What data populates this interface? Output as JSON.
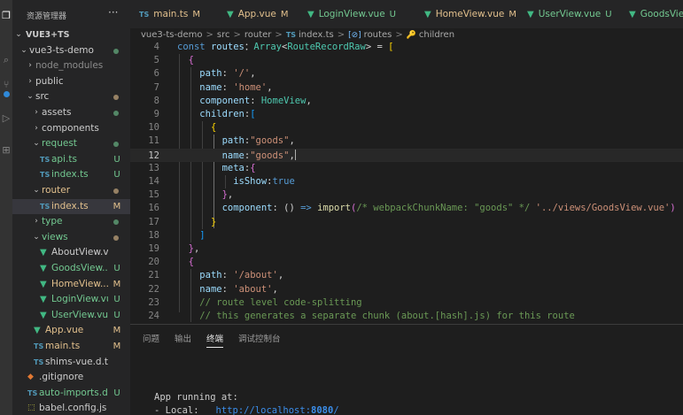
{
  "explorer": {
    "title": "资源管理器",
    "more": "···",
    "project": "VUE3+TS",
    "items": [
      {
        "label": "vue3-ts-demo",
        "kind": "folder",
        "open": true,
        "depth": 0,
        "status": "dot-green"
      },
      {
        "label": "node_modules",
        "kind": "folder",
        "open": false,
        "depth": 1,
        "status": "",
        "dim": true
      },
      {
        "label": "public",
        "kind": "folder",
        "open": false,
        "depth": 1,
        "status": ""
      },
      {
        "label": "src",
        "kind": "folder",
        "open": true,
        "depth": 1,
        "status": "dot-orange"
      },
      {
        "label": "assets",
        "kind": "folder",
        "open": false,
        "depth": 2,
        "status": "dot-green"
      },
      {
        "label": "components",
        "kind": "folder",
        "open": false,
        "depth": 2,
        "status": ""
      },
      {
        "label": "request",
        "kind": "folder",
        "open": true,
        "depth": 2,
        "status": "dot-green",
        "color": "green"
      },
      {
        "label": "api.ts",
        "kind": "ts",
        "depth": 3,
        "status": "U",
        "color": "green"
      },
      {
        "label": "index.ts",
        "kind": "ts",
        "depth": 3,
        "status": "U",
        "color": "green"
      },
      {
        "label": "router",
        "kind": "folder",
        "open": true,
        "depth": 2,
        "status": "dot-orange",
        "color": "mod"
      },
      {
        "label": "index.ts",
        "kind": "ts",
        "depth": 3,
        "status": "M",
        "color": "mod",
        "selected": true
      },
      {
        "label": "type",
        "kind": "folder",
        "open": false,
        "depth": 2,
        "status": "dot-green",
        "color": "green"
      },
      {
        "label": "views",
        "kind": "folder",
        "open": true,
        "depth": 2,
        "status": "dot-orange",
        "color": "green"
      },
      {
        "label": "AboutView.vue",
        "kind": "vue",
        "depth": 3,
        "status": ""
      },
      {
        "label": "GoodsView....",
        "kind": "vue",
        "depth": 3,
        "status": "U",
        "color": "green"
      },
      {
        "label": "HomeView....",
        "kind": "vue",
        "depth": 3,
        "status": "M",
        "color": "mod"
      },
      {
        "label": "LoginView.vue",
        "kind": "vue",
        "depth": 3,
        "status": "U",
        "color": "green"
      },
      {
        "label": "UserView.vue",
        "kind": "vue",
        "depth": 3,
        "status": "U",
        "color": "green"
      },
      {
        "label": "App.vue",
        "kind": "vue",
        "depth": 2,
        "status": "M",
        "color": "mod"
      },
      {
        "label": "main.ts",
        "kind": "ts",
        "depth": 2,
        "status": "M",
        "color": "mod"
      },
      {
        "label": "shims-vue.d.ts",
        "kind": "ts",
        "depth": 2,
        "status": ""
      },
      {
        "label": ".gitignore",
        "kind": "git",
        "depth": 1,
        "status": ""
      },
      {
        "label": "auto-imports.d.ts",
        "kind": "ts",
        "depth": 1,
        "status": "U",
        "color": "green"
      },
      {
        "label": "babel.config.js",
        "kind": "js",
        "depth": 1,
        "status": ""
      }
    ]
  },
  "tabs": [
    {
      "label": "main.ts",
      "kind": "ts",
      "badge": "M",
      "color": "mod",
      "active": false
    },
    {
      "label": "App.vue",
      "kind": "vue",
      "badge": "M",
      "color": "mod",
      "active": false
    },
    {
      "label": "LoginView.vue",
      "kind": "vue",
      "badge": "U",
      "color": "green",
      "active": false
    },
    {
      "label": "HomeView.vue",
      "kind": "vue",
      "badge": "M",
      "color": "mod",
      "active": false
    },
    {
      "label": "UserView.vue",
      "kind": "vue",
      "badge": "U",
      "color": "green",
      "active": false
    },
    {
      "label": "GoodsVie",
      "kind": "vue",
      "badge": "",
      "color": "green",
      "active": false
    }
  ],
  "breadcrumb": {
    "parts": [
      "vue3-ts-demo",
      "src",
      "router"
    ],
    "file": "index.ts",
    "symbol1": "routes",
    "symbol2": "children",
    "sep": ">",
    "ts_label": "TS",
    "sym_icon": "[⊘]",
    "sym2_icon": "🔑"
  },
  "editor": {
    "current_line": 12,
    "lines": [
      {
        "n": "4",
        "t": [
          [
            "kw",
            "const "
          ],
          [
            "pr",
            "routes"
          ],
          [
            "",
            "："
          ],
          [
            "ty",
            "Array"
          ],
          [
            "",
            "<"
          ],
          [
            "ty",
            "RouteRecordRaw"
          ],
          [
            "",
            "> = "
          ],
          [
            "br1",
            "["
          ]
        ]
      },
      {
        "n": "5",
        "t": [
          [
            "",
            "  "
          ],
          [
            "br2",
            "{"
          ]
        ]
      },
      {
        "n": "6",
        "t": [
          [
            "",
            "    "
          ],
          [
            "pr",
            "path"
          ],
          [
            "",
            ": "
          ],
          [
            "st",
            "'/'"
          ],
          [
            "",
            ","
          ]
        ]
      },
      {
        "n": "7",
        "t": [
          [
            "",
            "    "
          ],
          [
            "pr",
            "name"
          ],
          [
            "",
            ": "
          ],
          [
            "st",
            "'home'"
          ],
          [
            "",
            ","
          ]
        ]
      },
      {
        "n": "8",
        "t": [
          [
            "",
            "    "
          ],
          [
            "pr",
            "component"
          ],
          [
            "",
            ": "
          ],
          [
            "ty",
            "HomeView"
          ],
          [
            "",
            ","
          ]
        ]
      },
      {
        "n": "9",
        "t": [
          [
            "",
            "    "
          ],
          [
            "pr",
            "children"
          ],
          [
            "",
            ":"
          ],
          [
            "br3",
            "["
          ]
        ]
      },
      {
        "n": "10",
        "t": [
          [
            "",
            "      "
          ],
          [
            "br1",
            "{"
          ]
        ]
      },
      {
        "n": "11",
        "t": [
          [
            "",
            "        "
          ],
          [
            "pr",
            "path"
          ],
          [
            "",
            ":"
          ],
          [
            "st",
            "\"goods\""
          ],
          [
            "",
            ","
          ]
        ]
      },
      {
        "n": "12",
        "t": [
          [
            "",
            "        "
          ],
          [
            "pr",
            "name"
          ],
          [
            "",
            ":"
          ],
          [
            "st",
            "\"goods\""
          ],
          [
            "",
            ","
          ]
        ]
      },
      {
        "n": "13",
        "t": [
          [
            "",
            "        "
          ],
          [
            "pr",
            "meta"
          ],
          [
            "",
            ":"
          ],
          [
            "br2",
            "{"
          ]
        ]
      },
      {
        "n": "14",
        "t": [
          [
            "",
            "          "
          ],
          [
            "pr",
            "isShow"
          ],
          [
            "",
            ":"
          ],
          [
            "kw",
            "true"
          ]
        ]
      },
      {
        "n": "15",
        "t": [
          [
            "",
            "        "
          ],
          [
            "br2",
            "}"
          ],
          [
            "",
            ","
          ]
        ]
      },
      {
        "n": "16",
        "t": [
          [
            "",
            "        "
          ],
          [
            "pr",
            "component"
          ],
          [
            "",
            ": () "
          ],
          [
            "kw",
            "=>"
          ],
          [
            "fn",
            " import"
          ],
          [
            "br2",
            "("
          ],
          [
            "cm",
            "/* webpackChunkName: \"goods\" */"
          ],
          [
            "",
            " "
          ],
          [
            "st",
            "'../views/GoodsView.vue'"
          ],
          [
            "br2",
            ")"
          ]
        ]
      },
      {
        "n": "17",
        "t": [
          [
            "",
            "      "
          ],
          [
            "br1",
            "}"
          ]
        ]
      },
      {
        "n": "18",
        "t": [
          [
            "",
            "    "
          ],
          [
            "br3",
            "]"
          ]
        ]
      },
      {
        "n": "19",
        "t": [
          [
            "",
            "  "
          ],
          [
            "br2",
            "}"
          ],
          [
            "",
            ","
          ]
        ]
      },
      {
        "n": "20",
        "t": [
          [
            "",
            "  "
          ],
          [
            "br2",
            "{"
          ]
        ]
      },
      {
        "n": "21",
        "t": [
          [
            "",
            "    "
          ],
          [
            "pr",
            "path"
          ],
          [
            "",
            ": "
          ],
          [
            "st",
            "'/about'"
          ],
          [
            "",
            ","
          ]
        ]
      },
      {
        "n": "22",
        "t": [
          [
            "",
            "    "
          ],
          [
            "pr",
            "name"
          ],
          [
            "",
            ": "
          ],
          [
            "st",
            "'about'"
          ],
          [
            "",
            ","
          ]
        ]
      },
      {
        "n": "23",
        "t": [
          [
            "",
            "    "
          ],
          [
            "cm",
            "// route level code-splitting"
          ]
        ]
      },
      {
        "n": "24",
        "t": [
          [
            "",
            "    "
          ],
          [
            "cm",
            "// this generates a separate chunk (about.[hash].js) for this route"
          ]
        ]
      }
    ]
  },
  "panel": {
    "tabs": [
      "问题",
      "输出",
      "终端",
      "调试控制台"
    ],
    "active": "终端",
    "terminal_line1": "App running at:",
    "terminal_line2_prefix": "- Local:   ",
    "terminal_url_a": "http://localhost:",
    "terminal_url_port": "8080",
    "terminal_url_b": "/"
  },
  "colors": {
    "accent": "#007acc",
    "untracked": "#73c991",
    "modified": "#e2c08d"
  }
}
